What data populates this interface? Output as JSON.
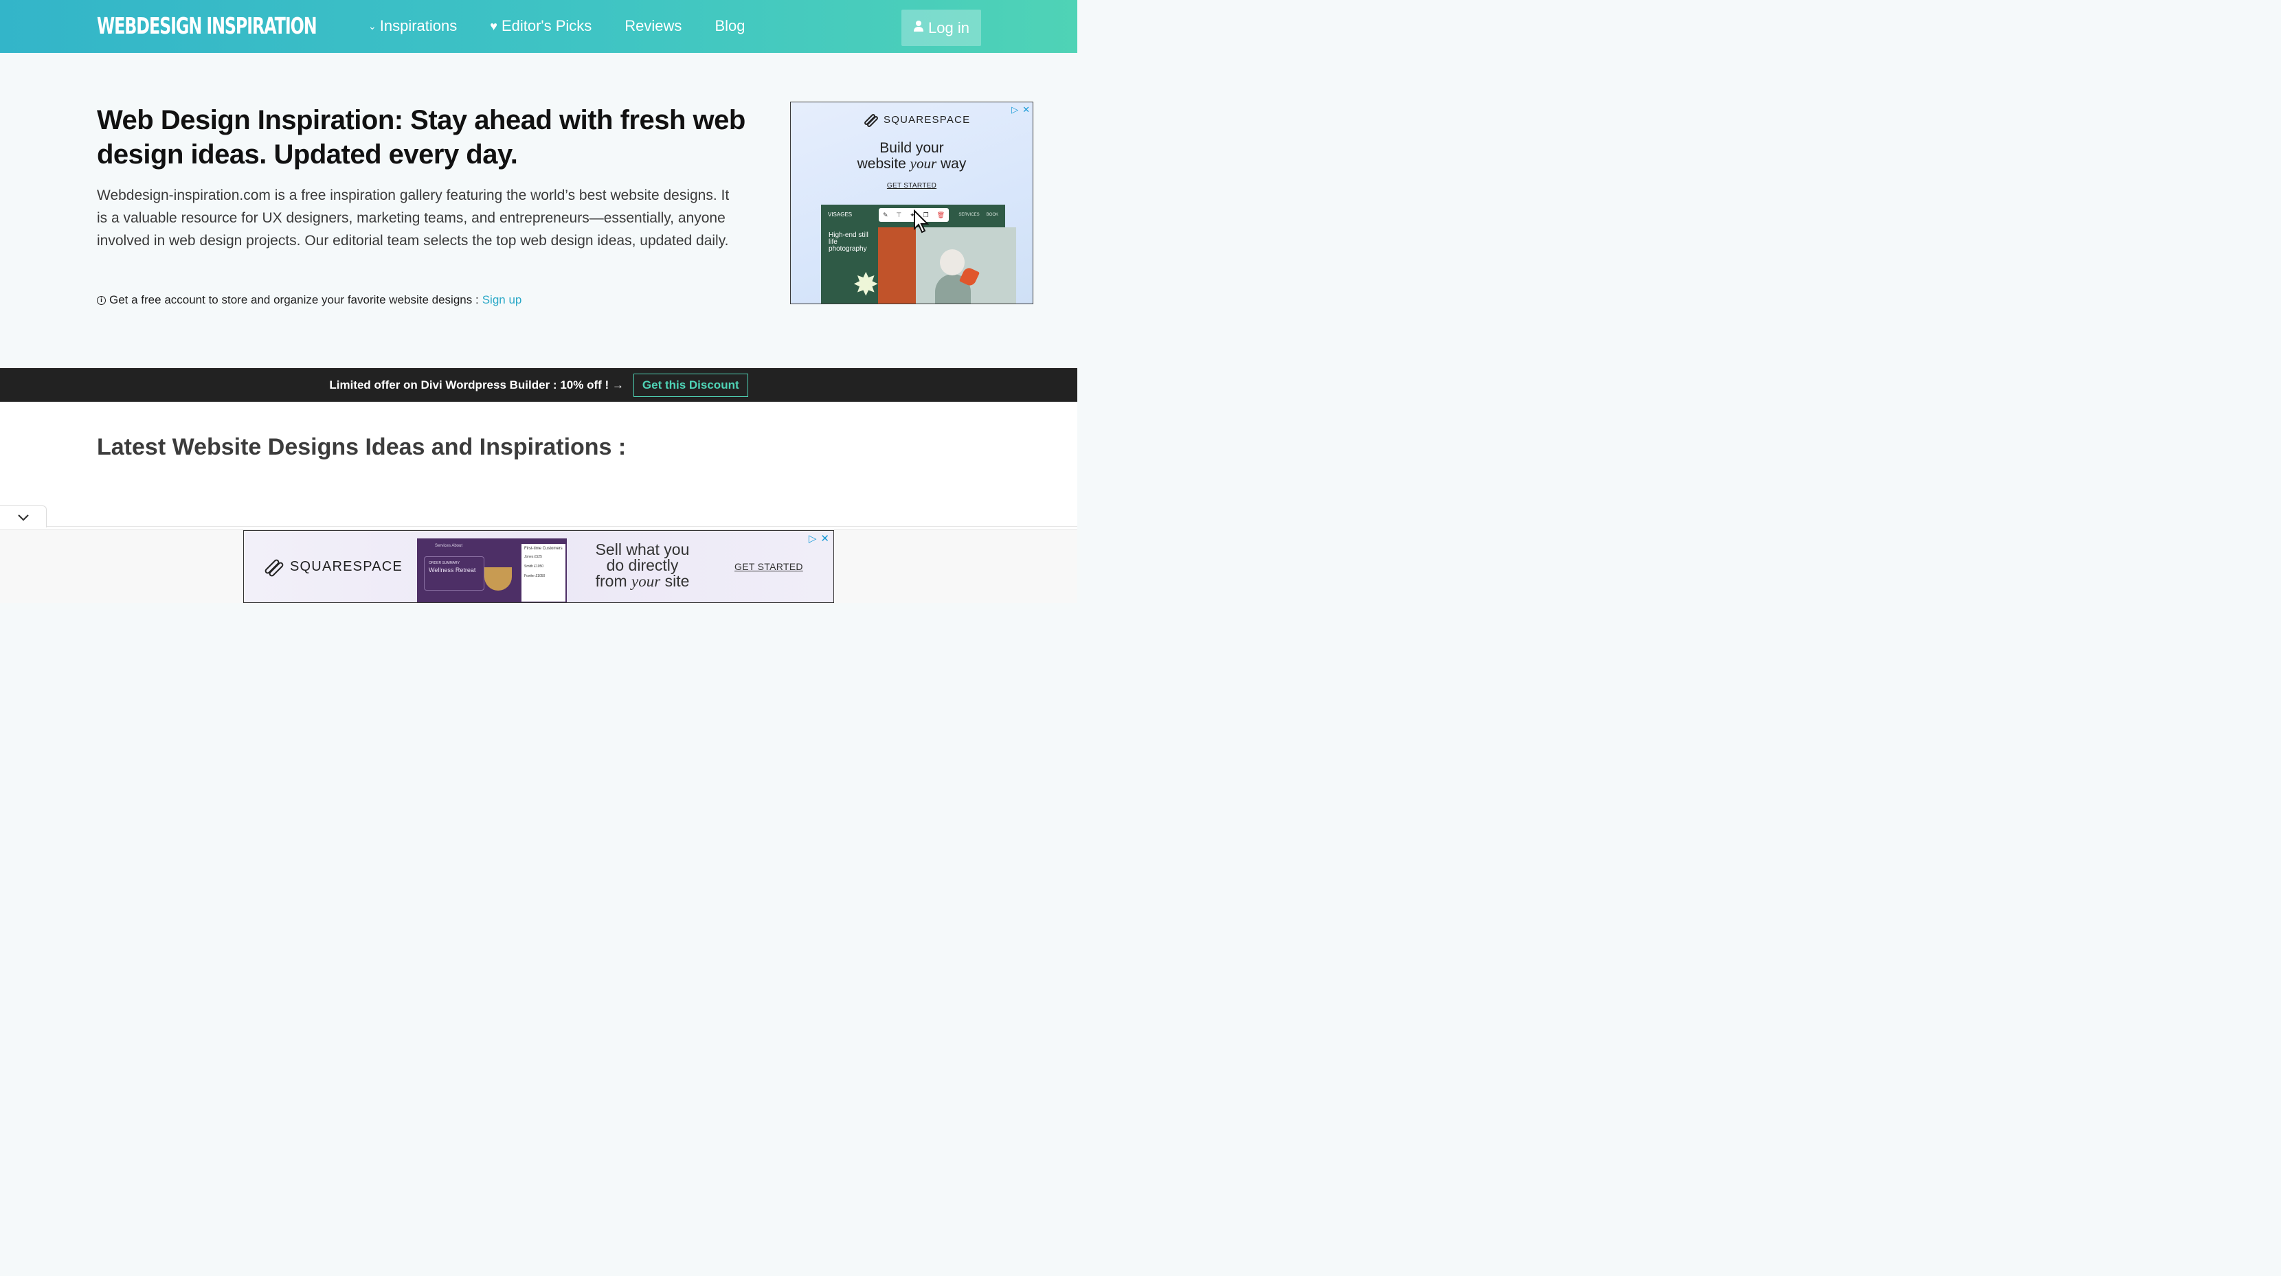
{
  "header": {
    "logo": "WEBDESIGN INSPIRATION",
    "nav": [
      {
        "label": "Inspirations",
        "icon": "chevron-down-icon"
      },
      {
        "label": "Editor's Picks",
        "icon": "heart-icon"
      },
      {
        "label": "Reviews"
      },
      {
        "label": "Blog"
      }
    ],
    "login_label": "Log in"
  },
  "hero": {
    "title": "Web Design Inspiration: Stay ahead with fresh web design ideas. Updated every day.",
    "description": "Webdesign-inspiration.com is a free inspiration gallery featuring the world’s best website designs. It is a valuable resource for UX designers, marketing teams, and entrepreneurs—essentially, anyone involved in web design projects. Our editorial team selects the top web design ideas, updated daily.",
    "note": "Get a free account to store and organize your favorite website designs :",
    "note_link": "Sign up"
  },
  "side_ad": {
    "brand": "SQUARESPACE",
    "headline_a": "Build your",
    "headline_b": "website",
    "headline_italic": "your",
    "headline_c": "way",
    "cta": "GET STARTED",
    "mock_brand": "VISAGES",
    "mock_nav": [
      "SERVICES",
      "BOOK"
    ],
    "mock_text": "High-end still life photography"
  },
  "offer": {
    "text": "Limited offer on Divi Wordpress Builder : 10% off ! →",
    "button": "Get this Discount"
  },
  "latest": {
    "title": "Latest Website Designs Ideas and Inspirations :"
  },
  "bottom_ad": {
    "brand": "SQUARESPACE",
    "headline_a": "Sell what you",
    "headline_b": "do directly",
    "headline_c": "from",
    "headline_italic": "your",
    "headline_d": "site",
    "cta": "GET STARTED",
    "mock_nav": "Services   About",
    "mock_card_label": "ORDER SUMMARY",
    "mock_card_title": "Wellness Retreat",
    "mock_table_title": "First-time Customers",
    "mock_rows": [
      "Jones  £525",
      "Smith  £1050",
      "Fowler  £1050"
    ]
  },
  "colors": {
    "header_gradient_start": "#33b5c9",
    "header_gradient_end": "#4fd3b6",
    "accent": "#4fd3b6",
    "link": "#2aa8c7",
    "offer_bar": "#222222"
  }
}
